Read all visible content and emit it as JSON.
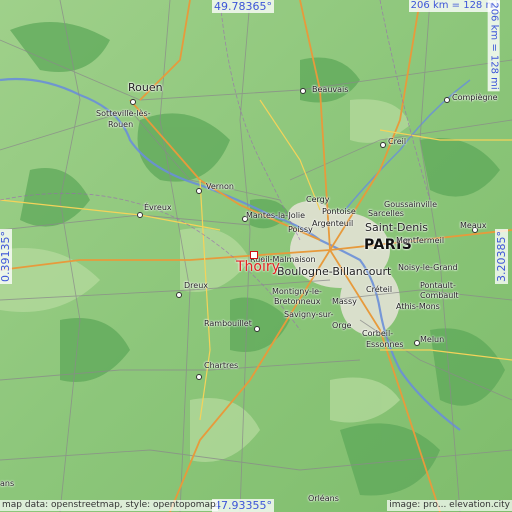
{
  "map": {
    "coords": {
      "top": "49.78365°",
      "bottom": "47.93355°",
      "left": "0.39135°",
      "right": "3.20385°"
    },
    "scale": {
      "horizontal": "206 km = 128 mi",
      "vertical": "206 km = 128 mi"
    },
    "attribution": {
      "left": "map data: openstreetmap, style: opentopomap",
      "right": "image: pro... elevation.city"
    },
    "focus": {
      "name": "Thoiry"
    },
    "places": [
      {
        "name": "Rouen"
      },
      {
        "name": "Sotteville-lès-"
      },
      {
        "name": "Rouen"
      },
      {
        "name": "Beauvais"
      },
      {
        "name": "Compiègne"
      },
      {
        "name": "Creil"
      },
      {
        "name": "Vernon"
      },
      {
        "name": "Évreux"
      },
      {
        "name": "Cergy"
      },
      {
        "name": "Goussainville"
      },
      {
        "name": "Mantes-la-Jolie"
      },
      {
        "name": "Pontoise"
      },
      {
        "name": "Sarcelles"
      },
      {
        "name": "Meaux"
      },
      {
        "name": "Argenteuil"
      },
      {
        "name": "Saint-Denis"
      },
      {
        "name": "Poissy"
      },
      {
        "name": "PARIS"
      },
      {
        "name": "Montfermeil"
      },
      {
        "name": "Rueil-Malmaison"
      },
      {
        "name": "Boulogne-Billancourt"
      },
      {
        "name": "Noisy-le-Grand"
      },
      {
        "name": "Dreux"
      },
      {
        "name": "Montigny-le-"
      },
      {
        "name": "Bretonneux"
      },
      {
        "name": "Créteil"
      },
      {
        "name": "Pontault-"
      },
      {
        "name": "Massy"
      },
      {
        "name": "Combault"
      },
      {
        "name": "Savigny-sur-"
      },
      {
        "name": "Athis-Mons"
      },
      {
        "name": "Rambouillet"
      },
      {
        "name": "Orge"
      },
      {
        "name": "Corbeil-"
      },
      {
        "name": "Essonnes"
      },
      {
        "name": "Melun"
      },
      {
        "name": "Chartres"
      },
      {
        "name": "ans"
      },
      {
        "name": "Orléans"
      }
    ]
  }
}
